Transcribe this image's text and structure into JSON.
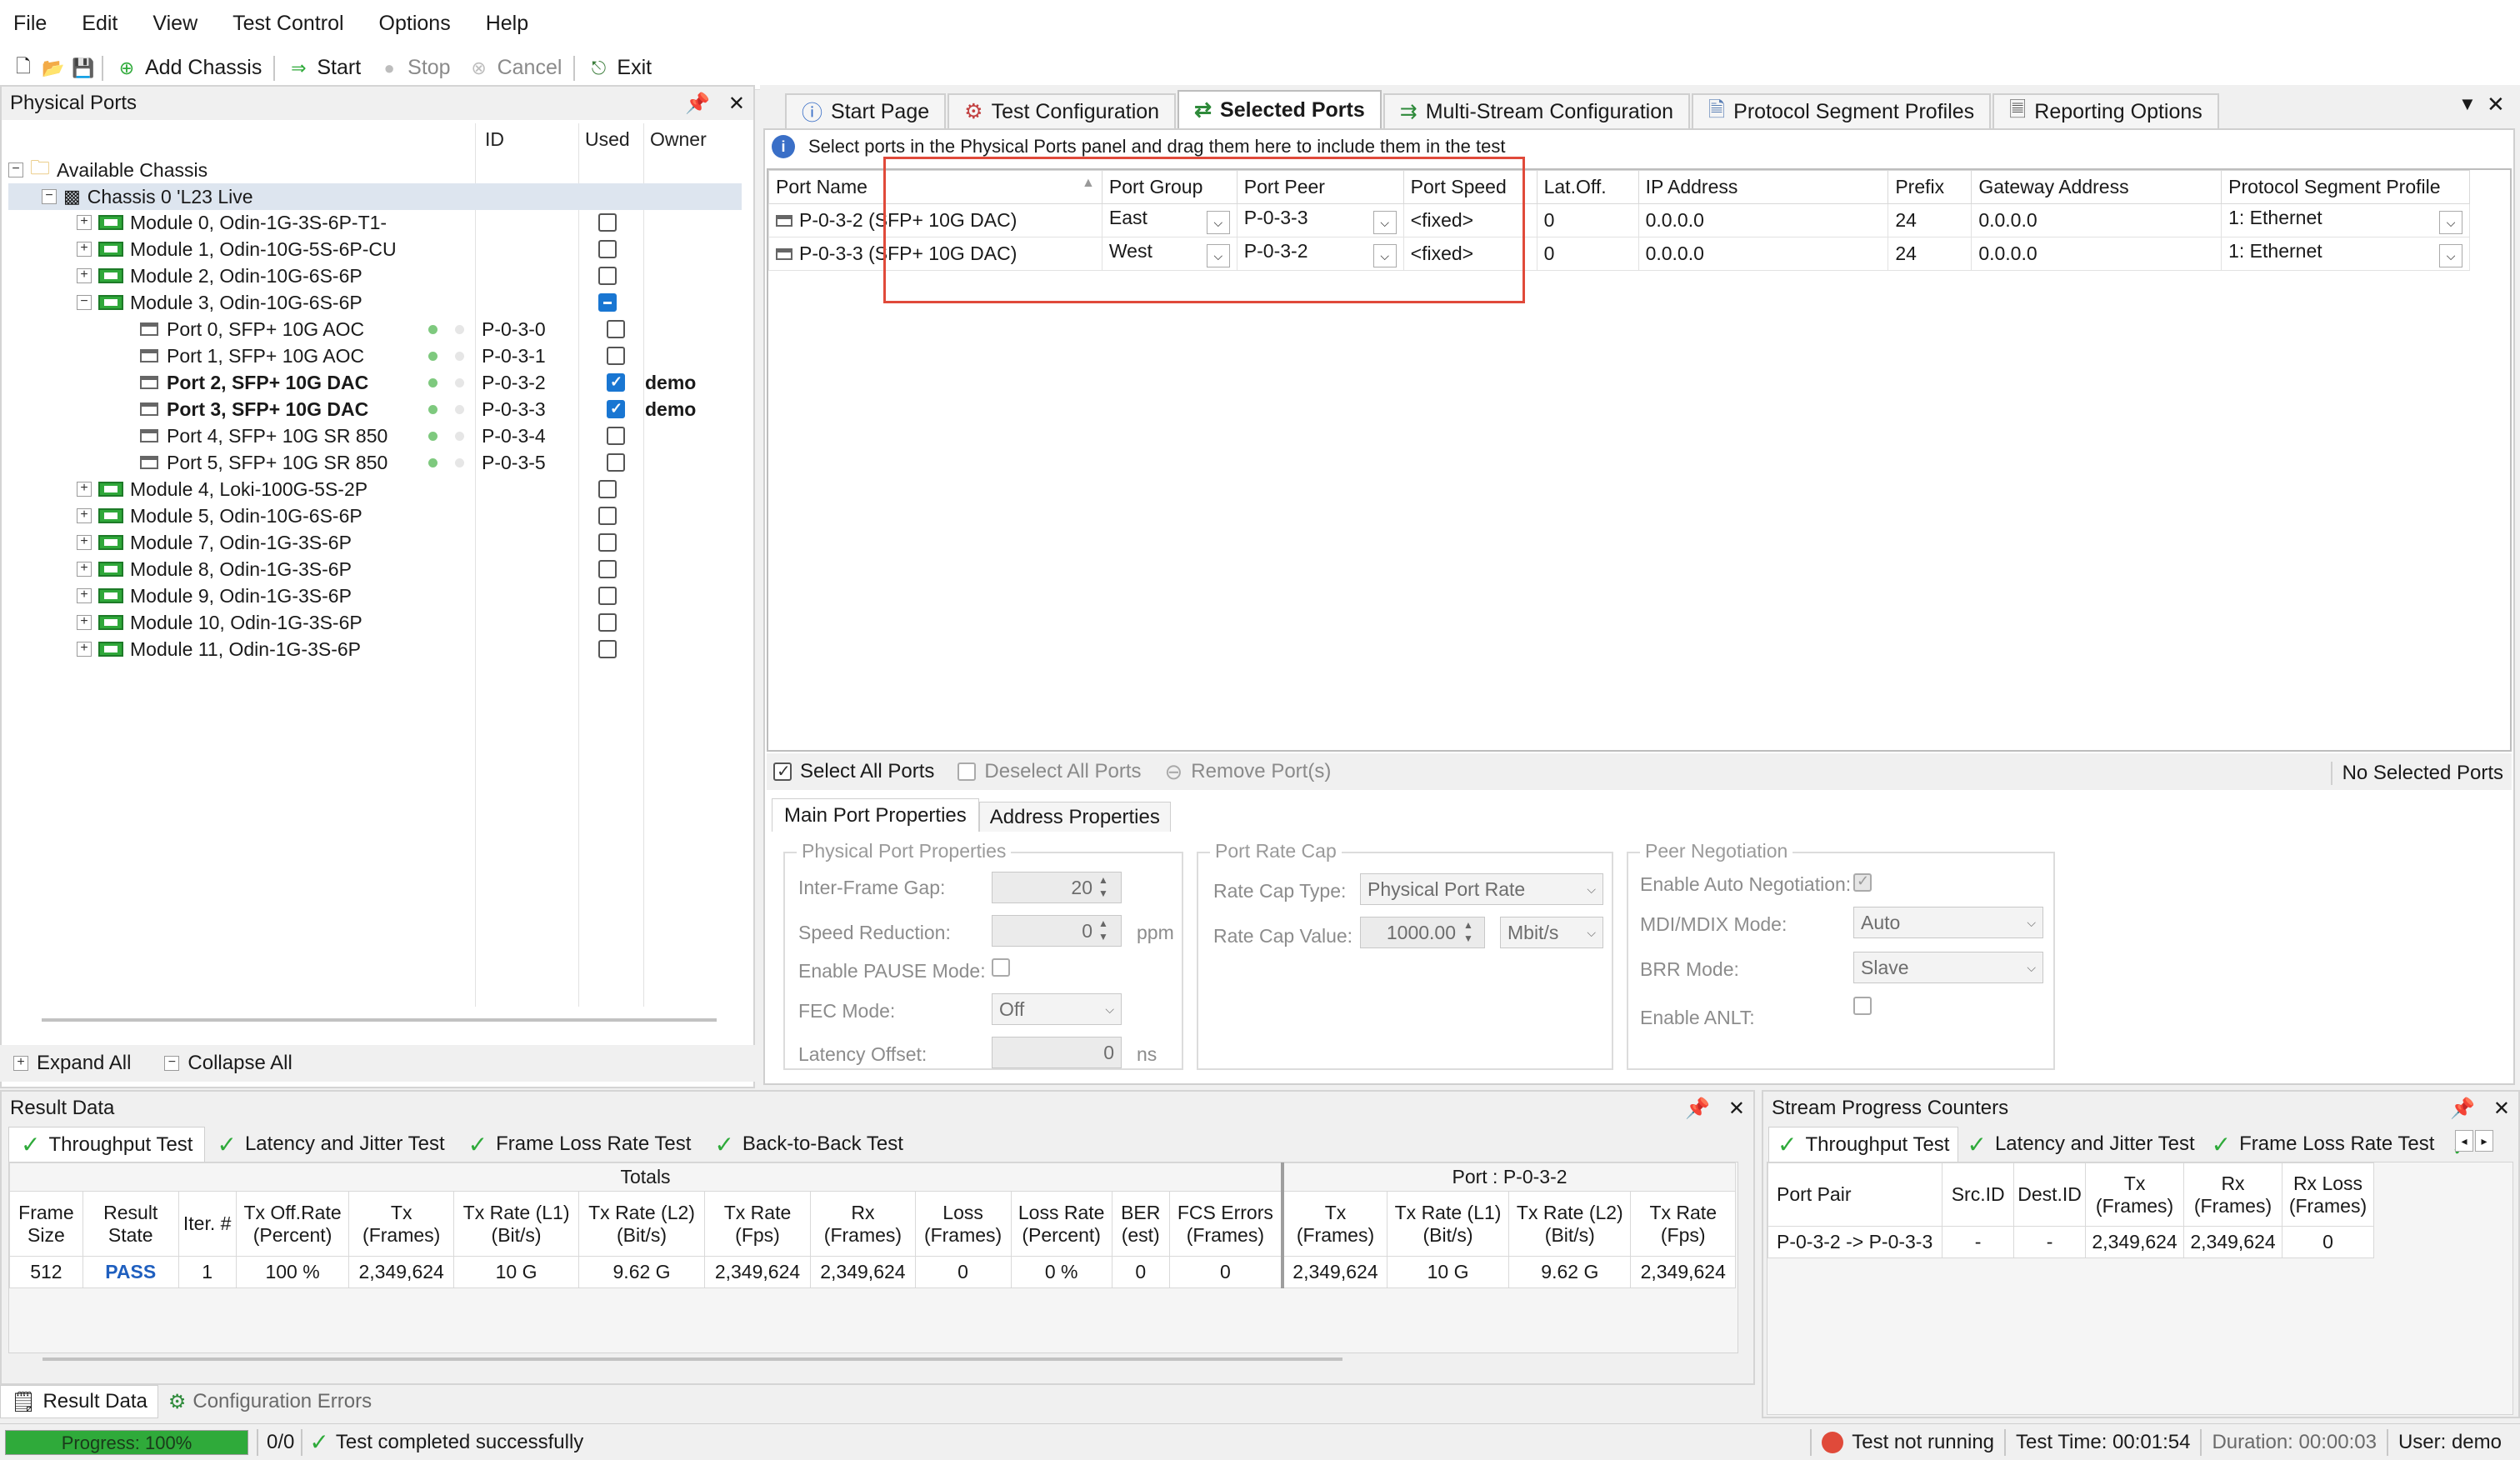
{
  "menu": [
    "File",
    "Edit",
    "View",
    "Test Control",
    "Options",
    "Help"
  ],
  "toolbar": {
    "add_chassis": "Add Chassis",
    "start": "Start",
    "stop": "Stop",
    "cancel": "Cancel",
    "exit": "Exit"
  },
  "physical_ports": {
    "title": "Physical Ports",
    "col_id": "ID",
    "col_used": "Used",
    "col_owner": "Owner",
    "root": "Available Chassis",
    "chassis": "Chassis 0 'L23 Live",
    "modules_top": [
      "Module 0, Odin-1G-3S-6P-T1-",
      "Module 1, Odin-10G-5S-6P-CU",
      "Module 2, Odin-10G-6S-6P",
      "Module 3, Odin-10G-6S-6P"
    ],
    "ports": [
      {
        "name": "Port 0, SFP+ 10G AOC",
        "id": "P-0-3-0",
        "owner": ""
      },
      {
        "name": "Port 1, SFP+ 10G AOC",
        "id": "P-0-3-1",
        "owner": ""
      },
      {
        "name": "Port 2, SFP+ 10G DAC",
        "id": "P-0-3-2",
        "owner": "demo"
      },
      {
        "name": "Port 3, SFP+ 10G DAC",
        "id": "P-0-3-3",
        "owner": "demo"
      },
      {
        "name": "Port 4, SFP+ 10G SR 850",
        "id": "P-0-3-4",
        "owner": ""
      },
      {
        "name": "Port 5, SFP+ 10G SR 850",
        "id": "P-0-3-5",
        "owner": ""
      }
    ],
    "modules_bottom": [
      "Module 4, Loki-100G-5S-2P",
      "Module 5, Odin-10G-6S-6P",
      "Module 7, Odin-1G-3S-6P",
      "Module 8, Odin-1G-3S-6P",
      "Module 9, Odin-1G-3S-6P",
      "Module 10, Odin-1G-3S-6P",
      "Module 11, Odin-1G-3S-6P"
    ],
    "expand_all": "Expand All",
    "collapse_all": "Collapse All"
  },
  "tabs": [
    "Start Page",
    "Test Configuration",
    "Selected Ports",
    "Multi-Stream Configuration",
    "Protocol Segment Profiles",
    "Reporting Options"
  ],
  "selected_ports": {
    "info": "Select ports in the Physical Ports panel and drag them here to include them in the test",
    "columns": [
      "Port Name",
      "Port Group",
      "Port Peer",
      "Port Speed",
      "Lat.Off.",
      "IP Address",
      "Prefix",
      "Gateway Address",
      "Protocol Segment Profile"
    ],
    "rows": [
      [
        "P-0-3-2 (SFP+ 10G DAC)",
        "East",
        "P-0-3-3",
        "<fixed>",
        "0",
        "0.0.0.0",
        "24",
        "0.0.0.0",
        "1: Ethernet"
      ],
      [
        "P-0-3-3 (SFP+ 10G DAC)",
        "West",
        "P-0-3-2",
        "<fixed>",
        "0",
        "0.0.0.0",
        "24",
        "0.0.0.0",
        "1: Ethernet"
      ]
    ],
    "select_all": "Select All Ports",
    "deselect_all": "Deselect All Ports",
    "remove": "Remove Port(s)",
    "status": "No Selected Ports"
  },
  "props": {
    "tab_main": "Main Port Properties",
    "tab_addr": "Address Properties",
    "physical_title": "Physical Port Properties",
    "ifg_label": "Inter-Frame Gap:",
    "ifg_value": "20",
    "speed_red_label": "Speed Reduction:",
    "speed_red_value": "0",
    "ppm": "ppm",
    "pause_label": "Enable PAUSE Mode:",
    "fec_label": "FEC Mode:",
    "fec_value": "Off",
    "latency_label": "Latency Offset:",
    "latency_value": "0",
    "ns": "ns",
    "rate_title": "Port Rate Cap",
    "rate_type_label": "Rate Cap Type:",
    "rate_type_value": "Physical Port Rate",
    "rate_val_label": "Rate Cap Value:",
    "rate_val_value": "1000.00",
    "rate_unit": "Mbit/s",
    "peer_title": "Peer Negotiation",
    "auto_neg_label": "Enable Auto Negotiation:",
    "mdi_label": "MDI/MDIX Mode:",
    "mdi_value": "Auto",
    "brr_label": "BRR Mode:",
    "brr_value": "Slave",
    "anlt_label": "Enable ANLT:"
  },
  "result_data": {
    "title": "Result Data",
    "tabs": [
      "Throughput Test",
      "Latency and Jitter Test",
      "Frame Loss Rate Test",
      "Back-to-Back Test"
    ],
    "group_totals": "Totals",
    "group_port": "Port : P-0-3-2",
    "columns": [
      "Frame Size",
      "Result State",
      "Iter. #",
      "Tx Off.Rate (Percent)",
      "Tx (Frames)",
      "Tx Rate (L1) (Bit/s)",
      "Tx Rate (L2) (Bit/s)",
      "Tx Rate (Fps)",
      "Rx (Frames)",
      "Loss (Frames)",
      "Loss Rate (Percent)",
      "BER (est)",
      "FCS Errors (Frames)",
      "Tx (Frames)",
      "Tx Rate (L1) (Bit/s)",
      "Tx Rate (L2) (Bit/s)",
      "Tx Rate (Fps)"
    ],
    "row": [
      "512",
      "PASS",
      "1",
      "100 %",
      "2,349,624",
      "10 G",
      "9.62 G",
      "2,349,624",
      "2,349,624",
      "0",
      "0 %",
      "0",
      "0",
      "2,349,624",
      "10 G",
      "9.62 G",
      "2,349,624"
    ],
    "bottom_tabs": [
      "Result Data",
      "Configuration Errors"
    ]
  },
  "stream_counters": {
    "title": "Stream Progress Counters",
    "tabs": [
      "Throughput Test",
      "Latency and Jitter Test",
      "Frame Loss Rate Test"
    ],
    "columns": [
      "Port Pair",
      "Src.ID",
      "Dest.ID",
      "Tx (Frames)",
      "Rx (Frames)",
      "Rx Loss (Frames)"
    ],
    "row": [
      "P-0-3-2 -> P-0-3-3",
      "-",
      "-",
      "2,349,624",
      "2,349,624",
      "0"
    ]
  },
  "status": {
    "progress_label": "Progress: 100%",
    "progress": 1.0,
    "count": "0/0",
    "message": "Test completed successfully",
    "run_state": "Test not running",
    "test_time": "Test Time: 00:01:54",
    "duration": "Duration: 00:00:03",
    "user": "User: demo"
  },
  "colors": {
    "accent": "#1976d2",
    "pass": "#1f5fbf",
    "highlight": "#e04a3a",
    "progress": "#2faa3a"
  }
}
